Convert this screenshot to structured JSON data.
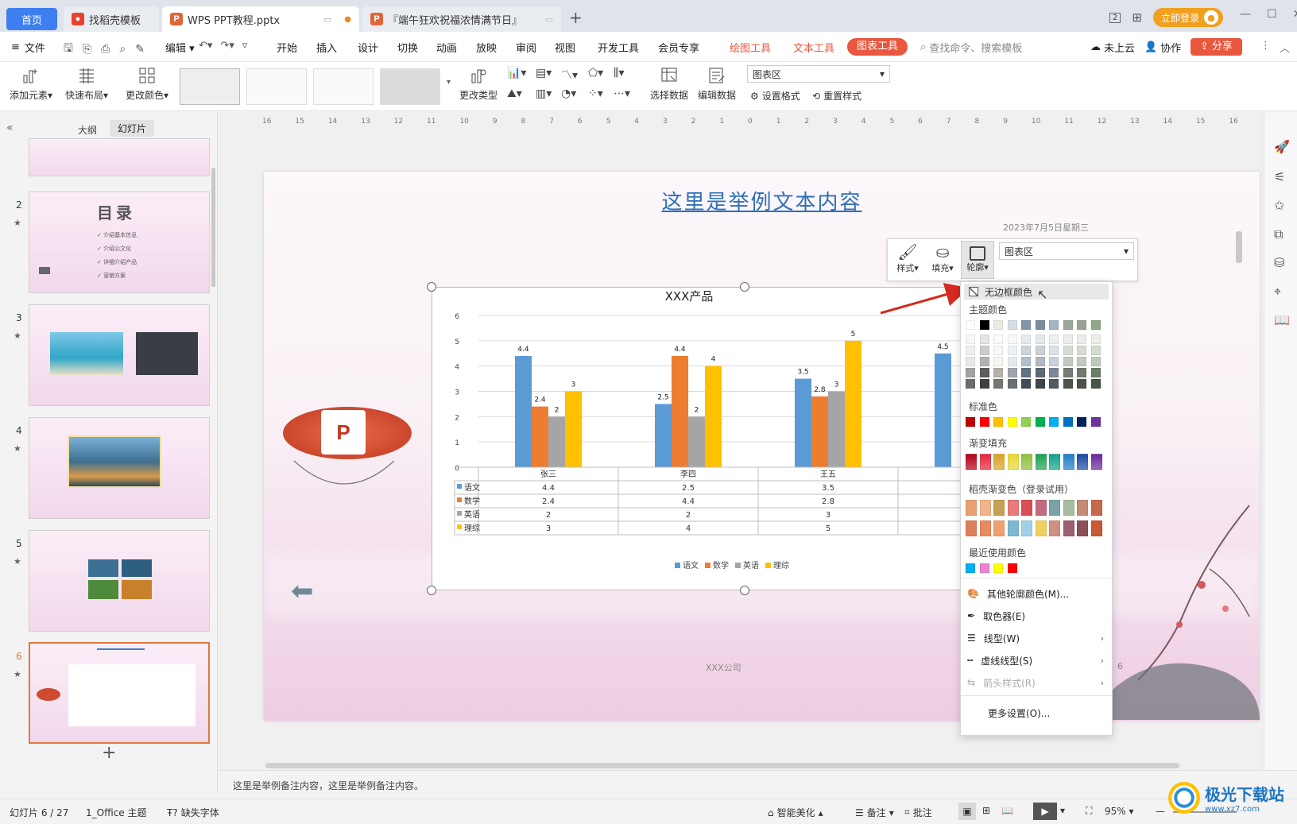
{
  "tabs": {
    "home": "首页",
    "template": "找稻壳模板",
    "doc": "WPS PPT教程.pptx",
    "event": "『端午狂欢祝福浓情满节日』"
  },
  "titlebar": {
    "login_label": "立即登录",
    "page_counter": "2"
  },
  "menu": {
    "file": "文件",
    "edit": "编辑",
    "items": [
      "开始",
      "插入",
      "设计",
      "切换",
      "动画",
      "放映",
      "审阅",
      "视图",
      "开发工具",
      "会员专享"
    ],
    "context_tools": [
      "绘图工具",
      "文本工具",
      "图表工具"
    ],
    "search_placeholder": "查找命令、搜索模板",
    "cloud": "未上云",
    "collab": "协作",
    "share": "分享"
  },
  "ribbon": {
    "add_element": "添加元素",
    "quick_layout": "快速布局",
    "change_color": "更改颜色",
    "change_type": "更改类型",
    "select_data": "选择数据",
    "edit_data": "编辑数据",
    "area_select": "图表区",
    "set_format": "设置格式",
    "reset_style": "重置样式"
  },
  "left_panel": {
    "tab_outline": "大纲",
    "tab_slides": "幻灯片",
    "slide2": {
      "num": "2",
      "title": "目录",
      "items": [
        "介绍基本信息",
        "介绍公文化",
        "详细介绍产品",
        "营销方案"
      ]
    },
    "slide_nums": [
      "3",
      "4",
      "5",
      "6"
    ],
    "add": "+"
  },
  "ruler_ticks": [
    "16",
    "15",
    "14",
    "13",
    "12",
    "11",
    "10",
    "9",
    "8",
    "7",
    "6",
    "5",
    "4",
    "3",
    "2",
    "1",
    "0",
    "1",
    "2",
    "3",
    "4",
    "5",
    "6",
    "7",
    "8",
    "9",
    "10",
    "11",
    "12",
    "13",
    "14",
    "15",
    "16"
  ],
  "slide": {
    "heading": "这里是举例文本内容",
    "date": "2023年7月5日星期三",
    "company": "XXX公司",
    "page": "6"
  },
  "chart_data": {
    "type": "bar",
    "title": "XXX产品",
    "categories": [
      "张三",
      "李四",
      "王五"
    ],
    "series": [
      {
        "name": "语文",
        "values": [
          4.4,
          2.5,
          3.5
        ],
        "color": "#5b9bd5"
      },
      {
        "name": "数学",
        "values": [
          2.4,
          4.4,
          2.8
        ],
        "color": "#ed7d31"
      },
      {
        "name": "英语",
        "values": [
          2,
          2,
          3
        ],
        "color": "#a5a5a5"
      },
      {
        "name": "理综",
        "values": [
          3,
          4,
          5
        ],
        "color": "#ffc000"
      }
    ],
    "partial_category_value": 4.5,
    "yticks": [
      "6",
      "5",
      "4",
      "3",
      "2",
      "1",
      "0"
    ],
    "ylim": [
      0,
      6
    ],
    "legend": "bottom",
    "data_table": true
  },
  "float_toolbar": {
    "style": "样式",
    "fill": "填充",
    "outline": "轮廓",
    "area": "图表区"
  },
  "dropdown": {
    "no_border": "无边框颜色",
    "theme": "主题颜色",
    "standard": "标准色",
    "gradient": "渐变填充",
    "docer_gradient": "稻壳渐变色（登录试用）",
    "recent": "最近使用颜色",
    "more_colors": "其他轮廓颜色(M)...",
    "eyedropper": "取色器(E)",
    "line_type": "线型(W)",
    "dash_type": "虚线线型(S)",
    "arrow_style": "箭头样式(R)",
    "more_settings": "更多设置(O)...",
    "theme_top": [
      "#ffffff",
      "#000000",
      "#eeece1",
      "#d5dce4",
      "#7f96ad",
      "#7c8b99",
      "#a2b4c5",
      "#9ba79a",
      "#96a591",
      "#8fa887"
    ],
    "standard_colors": [
      "#c00000",
      "#ff0000",
      "#ffc000",
      "#ffff00",
      "#92d050",
      "#00b050",
      "#00b0f0",
      "#0070c0",
      "#002060",
      "#7030a0"
    ],
    "gradient_colors": [
      "#b5001b",
      "#e5263c",
      "#d9a326",
      "#e6d830",
      "#8fbf3e",
      "#1aa350",
      "#12a38a",
      "#1f7fc6",
      "#1a4aa0",
      "#6a2a9a"
    ],
    "docer1": [
      "#e9a070",
      "#f2b38a",
      "#c8a054",
      "#e87a7a",
      "#d94f55",
      "#c36b7f",
      "#7aa3a8",
      "#a8bca0",
      "#c28b72",
      "#c46a4c"
    ],
    "docer2": [
      "#dd7f5a",
      "#e8895f",
      "#f0a070",
      "#7ab8d4",
      "#9fd0e8",
      "#f0d060",
      "#d09080",
      "#9e6070",
      "#8a5058",
      "#c85a35"
    ],
    "recent_colors": [
      "#00b0f0",
      "#f080d0",
      "#ffff00",
      "#ff0000"
    ]
  },
  "notes": "这里是举例备注内容，这里是举例备注内容。",
  "status": {
    "slide_counter": "幻灯片 6 / 27",
    "theme": "1_Office 主题",
    "missing_font": "缺失字体",
    "beautify": "智能美化",
    "notes_btn": "备注",
    "comment_btn": "批注",
    "zoom": "95%"
  },
  "watermark": "极光下载站",
  "watermark_url": "www.xz7.com"
}
